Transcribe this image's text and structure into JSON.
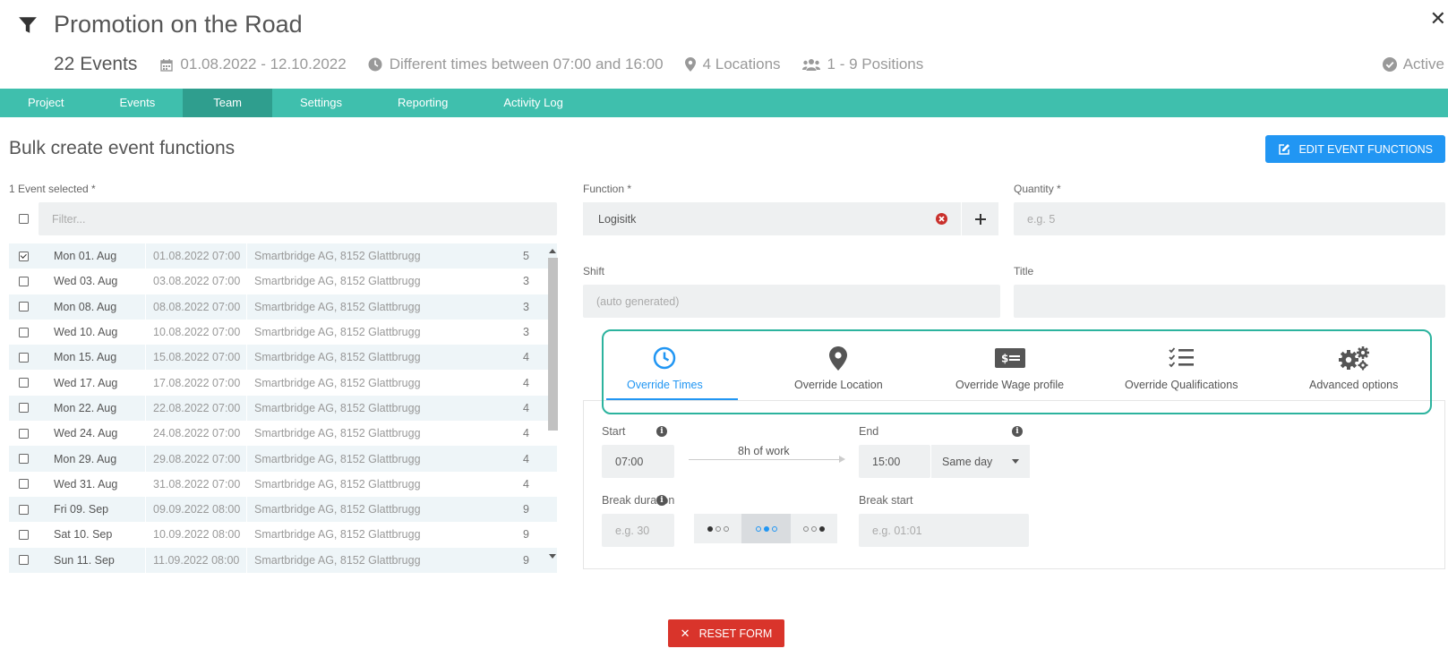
{
  "header": {
    "title": "Promotion on the Road",
    "event_count": "22 Events",
    "date_range": "01.08.2022 - 12.10.2022",
    "times": "Different times between 07:00 and 16:00",
    "locations": "4 Locations",
    "positions": "1 - 9 Positions",
    "status": "Active",
    "close_glyph": "✕"
  },
  "tabs": [
    {
      "label": "Project"
    },
    {
      "label": "Events"
    },
    {
      "label": "Team",
      "active": true
    },
    {
      "label": "Settings"
    },
    {
      "label": "Reporting"
    },
    {
      "label": "Activity Log"
    }
  ],
  "page": {
    "heading": "Bulk create event functions",
    "edit_button": "EDIT EVENT FUNCTIONS"
  },
  "events": {
    "label": "1 Event selected *",
    "filter_placeholder": "Filter...",
    "rows": [
      {
        "day": "Mon 01. Aug",
        "datetime": "01.08.2022 07:00",
        "location": "Smartbridge AG, 8152 Glattbrugg",
        "count": "5",
        "checked": true
      },
      {
        "day": "Wed 03. Aug",
        "datetime": "03.08.2022 07:00",
        "location": "Smartbridge AG, 8152 Glattbrugg",
        "count": "3",
        "checked": false
      },
      {
        "day": "Mon 08. Aug",
        "datetime": "08.08.2022 07:00",
        "location": "Smartbridge AG, 8152 Glattbrugg",
        "count": "3",
        "checked": false
      },
      {
        "day": "Wed 10. Aug",
        "datetime": "10.08.2022 07:00",
        "location": "Smartbridge AG, 8152 Glattbrugg",
        "count": "3",
        "checked": false
      },
      {
        "day": "Mon 15. Aug",
        "datetime": "15.08.2022 07:00",
        "location": "Smartbridge AG, 8152 Glattbrugg",
        "count": "4",
        "checked": false
      },
      {
        "day": "Wed 17. Aug",
        "datetime": "17.08.2022 07:00",
        "location": "Smartbridge AG, 8152 Glattbrugg",
        "count": "4",
        "checked": false
      },
      {
        "day": "Mon 22. Aug",
        "datetime": "22.08.2022 07:00",
        "location": "Smartbridge AG, 8152 Glattbrugg",
        "count": "4",
        "checked": false
      },
      {
        "day": "Wed 24. Aug",
        "datetime": "24.08.2022 07:00",
        "location": "Smartbridge AG, 8152 Glattbrugg",
        "count": "4",
        "checked": false
      },
      {
        "day": "Mon 29. Aug",
        "datetime": "29.08.2022 07:00",
        "location": "Smartbridge AG, 8152 Glattbrugg",
        "count": "4",
        "checked": false
      },
      {
        "day": "Wed 31. Aug",
        "datetime": "31.08.2022 07:00",
        "location": "Smartbridge AG, 8152 Glattbrugg",
        "count": "4",
        "checked": false
      },
      {
        "day": "Fri 09. Sep",
        "datetime": "09.09.2022 08:00",
        "location": "Smartbridge AG, 8152 Glattbrugg",
        "count": "9",
        "checked": false
      },
      {
        "day": "Sat 10. Sep",
        "datetime": "10.09.2022 08:00",
        "location": "Smartbridge AG, 8152 Glattbrugg",
        "count": "9",
        "checked": false
      },
      {
        "day": "Sun 11. Sep",
        "datetime": "11.09.2022 08:00",
        "location": "Smartbridge AG, 8152 Glattbrugg",
        "count": "9",
        "checked": false
      }
    ]
  },
  "form": {
    "function_label": "Function *",
    "function_value": "Logisitk",
    "quantity_label": "Quantity *",
    "quantity_placeholder": "e.g. 5",
    "shift_label": "Shift",
    "shift_placeholder": "(auto generated)",
    "title_label": "Title",
    "title_value": ""
  },
  "override_tabs": [
    {
      "label": "Override Times",
      "icon": "clock-icon",
      "active": true
    },
    {
      "label": "Override Location",
      "icon": "map-marker-icon"
    },
    {
      "label": "Override Wage profile",
      "icon": "money-icon"
    },
    {
      "label": "Override Qualifications",
      "icon": "checklist-icon"
    },
    {
      "label": "Advanced options",
      "icon": "gears-icon"
    }
  ],
  "times": {
    "start_label": "Start",
    "start_value": "07:00",
    "work_label": "8h of work",
    "end_label": "End",
    "end_value": "15:00",
    "day_option": "Same day",
    "break_duration_label": "Break duration",
    "break_duration_placeholder": "e.g. 30",
    "break_start_label": "Break start",
    "break_start_placeholder": "e.g. 01:01"
  },
  "footer": {
    "reset_label": "RESET FORM"
  },
  "colors": {
    "accent": "#3fbfad",
    "primary": "#2196f3",
    "danger": "#d9342b",
    "highlight_border": "#2cb39e"
  }
}
